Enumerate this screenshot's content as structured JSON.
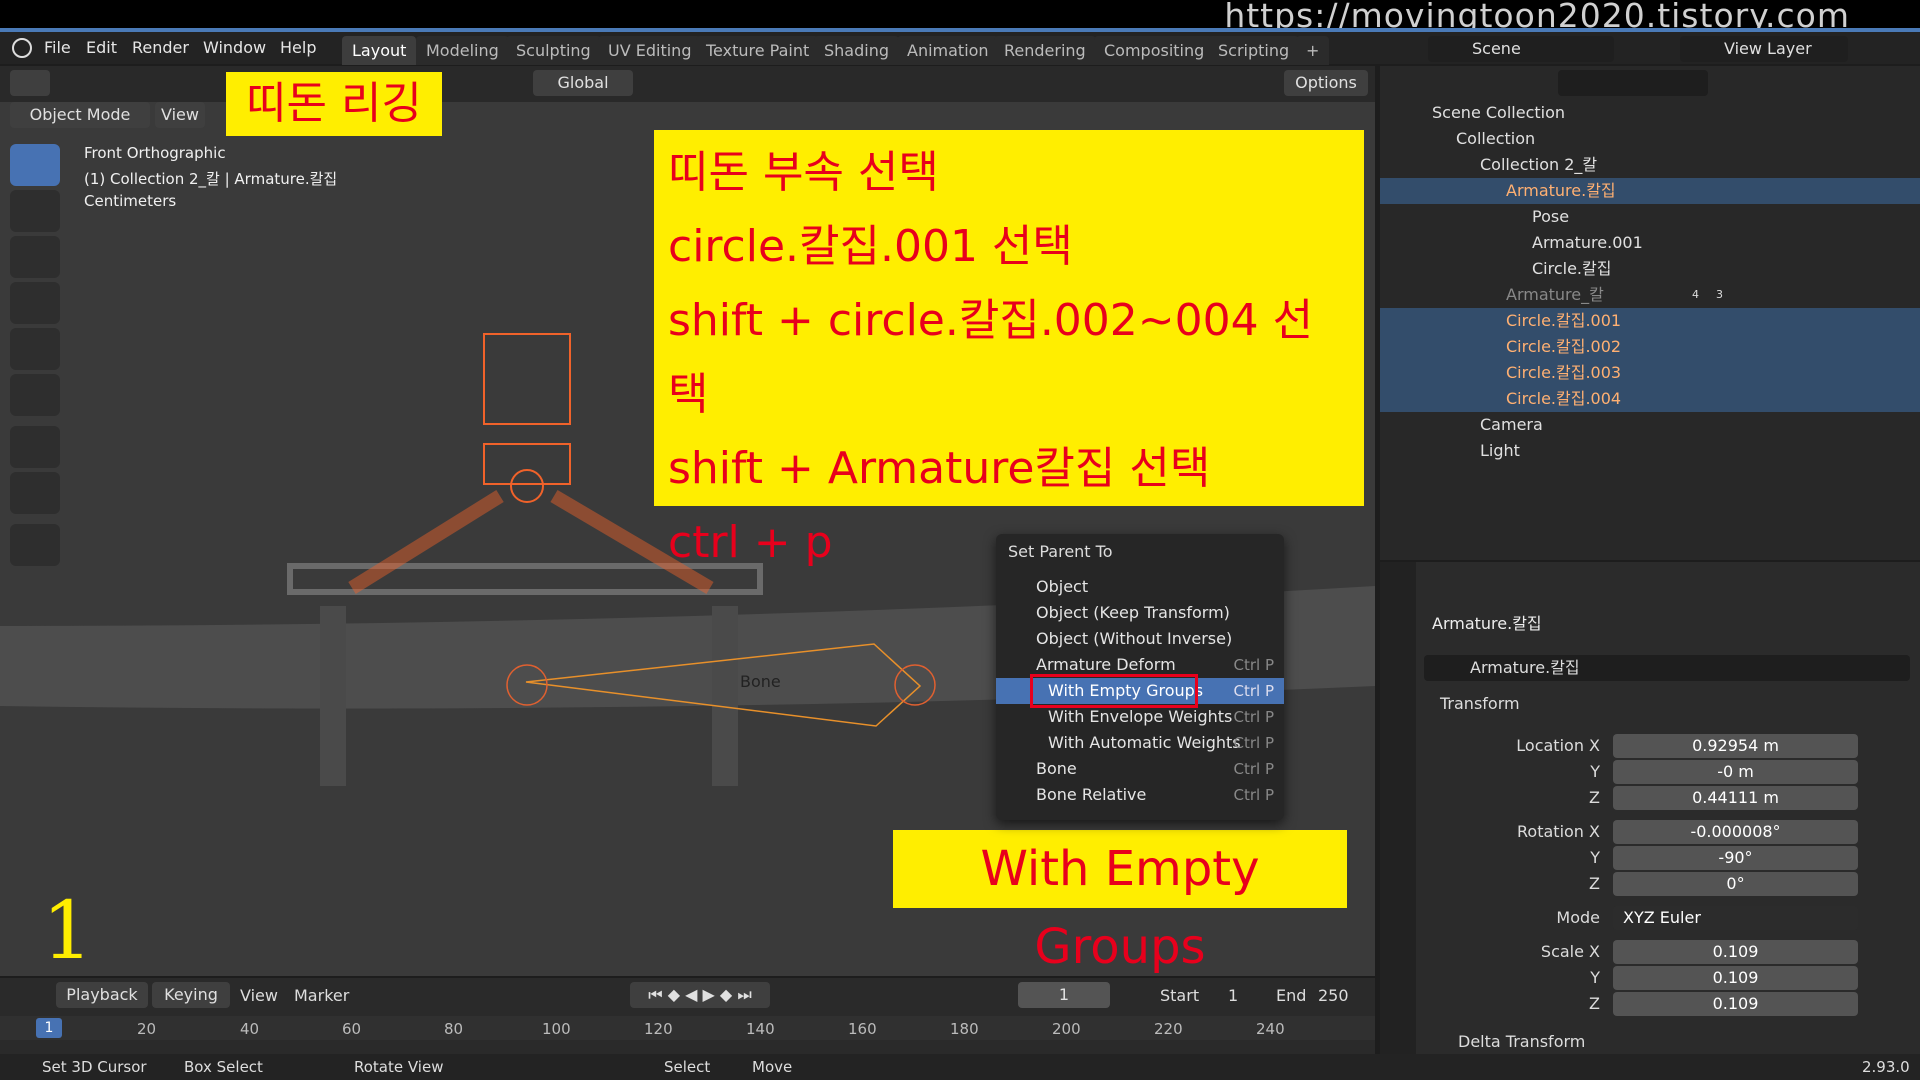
{
  "watermark": "https://movingtoon2020.tistory.com",
  "menus": [
    "File",
    "Edit",
    "Render",
    "Window",
    "Help"
  ],
  "workspaces": [
    "Layout",
    "Modeling",
    "Sculpting",
    "UV Editing",
    "Texture Paint",
    "Shading",
    "Animation",
    "Rendering",
    "Compositing",
    "Scripting"
  ],
  "scene": "Scene",
  "view_layer": "View Layer",
  "viewport": {
    "mode": "Object Mode",
    "view": "View",
    "orientation": "Global",
    "options": "Options",
    "info1": "Front Orthographic",
    "info2": "(1) Collection 2_칼 | Armature.칼집",
    "info3": "Centimeters",
    "bone_label": "Bone",
    "frame_number": "1"
  },
  "annotations": {
    "title": "띠돈 리깅",
    "steps": [
      "띠돈 부속 선택",
      "circle.칼집.001 선택",
      "shift + circle.칼집.002~004 선택",
      "shift + Armature칼집 선택",
      "ctrl + p"
    ],
    "callout": "With Empty Groups"
  },
  "popup": {
    "title": "Set Parent To",
    "items": [
      {
        "label": "Object",
        "shortcut": ""
      },
      {
        "label": "Object (Keep Transform)",
        "shortcut": ""
      },
      {
        "label": "Object (Without Inverse)",
        "shortcut": ""
      },
      {
        "label": "Armature Deform",
        "shortcut": "Ctrl P"
      },
      {
        "label": "With Empty Groups",
        "shortcut": "Ctrl P"
      },
      {
        "label": "With Envelope Weights",
        "shortcut": "Ctrl P"
      },
      {
        "label": "With Automatic Weights",
        "shortcut": "Ctrl P"
      },
      {
        "label": "Bone",
        "shortcut": "Ctrl P"
      },
      {
        "label": "Bone Relative",
        "shortcut": "Ctrl P"
      }
    ]
  },
  "outliner": {
    "rows": [
      "Scene Collection",
      "Collection",
      "Collection 2_칼",
      "Armature.칼집",
      "Pose",
      "Armature.001",
      "Circle.칼집",
      "Armature_칼",
      "Circle.칼집.001",
      "Circle.칼집.002",
      "Circle.칼집.003",
      "Circle.칼집.004",
      "Camera",
      "Light"
    ],
    "badge4": "4",
    "badge3": "3"
  },
  "properties": {
    "object": "Armature.칼집",
    "datablock": "Armature.칼집",
    "transform": "Transform",
    "location_label": "Location X",
    "location": [
      "0.92954 m",
      "-0 m",
      "0.44111 m"
    ],
    "rotation_label": "Rotation X",
    "rotation": [
      "-0.000008°",
      "-90°",
      "0°"
    ],
    "mode_label": "Mode",
    "mode": "XYZ Euler",
    "scale_label": "Scale X",
    "scale": [
      "0.109",
      "0.109",
      "0.109"
    ],
    "y": "Y",
    "z": "Z",
    "delta": "Delta Transform"
  },
  "timeline": {
    "playback": "Playback",
    "keying": "Keying",
    "view": "View",
    "marker": "Marker",
    "current": "1",
    "start_label": "Start",
    "start": "1",
    "end_label": "End",
    "end": "250",
    "ticks": [
      "1",
      "20",
      "40",
      "60",
      "80",
      "100",
      "120",
      "140",
      "160",
      "180",
      "200",
      "220",
      "240"
    ]
  },
  "status": {
    "a": "Set 3D Cursor",
    "b": "Box Select",
    "c": "Rotate View",
    "d": "Select",
    "e": "Move",
    "version": "2.93.0"
  },
  "colors": {
    "highlight": "#4772b3",
    "selected_orange": "#f0622a",
    "yellow": "#ffee00",
    "red_text": "#e8001c"
  }
}
